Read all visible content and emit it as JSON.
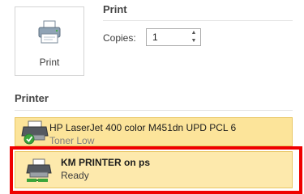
{
  "print_section": {
    "title": "Print",
    "print_button_label": "Print",
    "copies_label": "Copies:",
    "copies_value": "1"
  },
  "printer_section": {
    "title": "Printer",
    "printers": [
      {
        "name": "HP LaserJet 400 color M451dn UPD PCL 6",
        "status": "Toner Low",
        "icon": "printer-default-check-icon"
      },
      {
        "name": "KM PRINTER on ps",
        "status": "Ready",
        "icon": "printer-network-icon"
      }
    ]
  },
  "colors": {
    "selected_row": "#fce49a",
    "highlight_border": "#ef0000",
    "check_green": "#3aa53a"
  }
}
